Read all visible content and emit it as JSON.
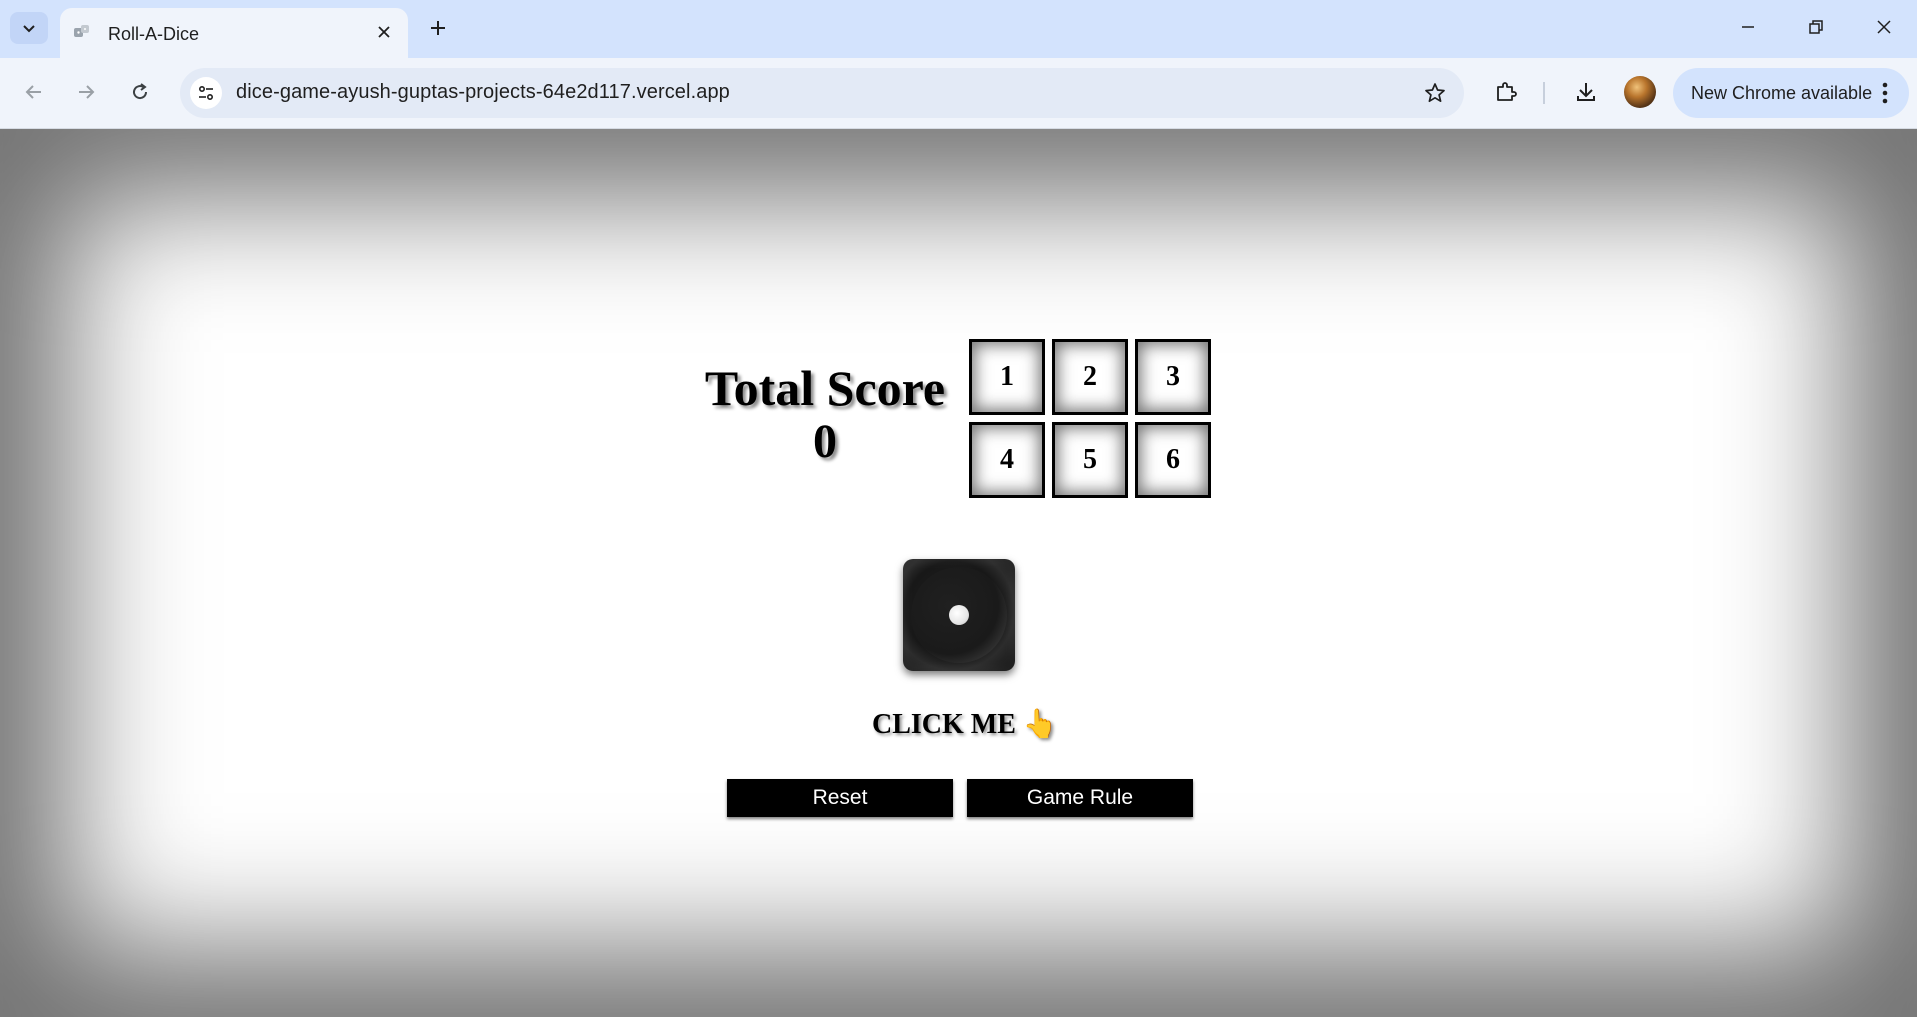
{
  "browser": {
    "tab": {
      "title": "Roll-A-Dice"
    },
    "address_bar": {
      "url": "dice-game-ayush-guptas-projects-64e2d117.vercel.app"
    },
    "update_pill": {
      "label": "New Chrome available"
    }
  },
  "game": {
    "score_label": "Total Score",
    "score_value": "0",
    "numbers": [
      "1",
      "2",
      "3",
      "4",
      "5",
      "6"
    ],
    "dice_face": 1,
    "click_prompt": "CLICK ME",
    "hand_icon": "👆",
    "reset_label": "Reset",
    "rules_label": "Game Rule"
  }
}
